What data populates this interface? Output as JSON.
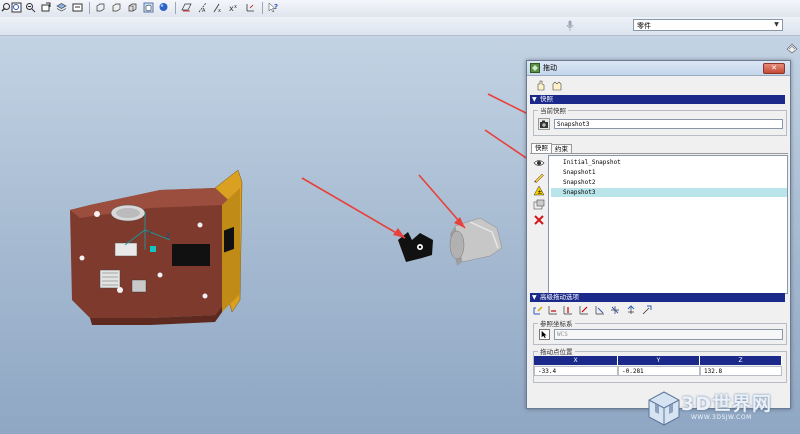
{
  "filter": {
    "value": "零件"
  },
  "dialog": {
    "title": "拖动",
    "snapshots_section": "快照",
    "current_snapshot_label": "当前快照",
    "current_snapshot_value": "Snapshot3",
    "tabs": [
      {
        "label": "快照"
      },
      {
        "label": "约束"
      }
    ],
    "snapshots": [
      "Initial_Snapshot",
      "Snapshot1",
      "Snapshot2",
      "Snapshot3"
    ],
    "selected_snapshot": "Snapshot3",
    "advanced_section": "高级拖动选项",
    "ref_csys_label": "参照坐标系",
    "ref_csys_value": "WCS",
    "drag_point_label": "拖动点位置",
    "table": {
      "columns": [
        "X",
        "Y",
        "Z"
      ],
      "values": [
        "-33.4",
        "-0.281",
        "132.8"
      ]
    }
  },
  "watermark": {
    "title": "3D世界网",
    "url": "WWW.3DSJW.COM"
  },
  "colors": {
    "section_bar": "#1b2a8a",
    "selection": "#b9e5ea",
    "arrow": "#e8403a",
    "part_orange": "#d9a021",
    "part_brown": "#7e3a2c"
  }
}
